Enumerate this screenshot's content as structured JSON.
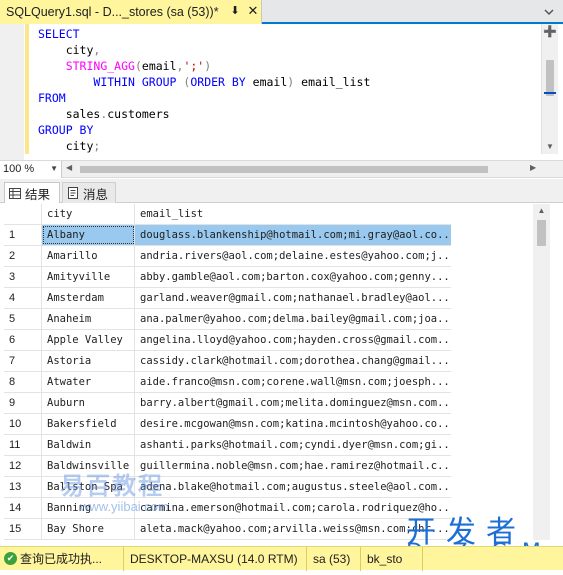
{
  "tab": {
    "title": "SQLQuery1.sql - D..._stores (sa (53))*"
  },
  "editor": {
    "lines": [
      [
        {
          "t": "SELECT",
          "c": "kw"
        }
      ],
      [
        {
          "t": "    city",
          "c": "id"
        },
        {
          "t": ",",
          "c": "gr"
        }
      ],
      [
        {
          "t": "    ",
          "c": "id"
        },
        {
          "t": "STRING_AGG",
          "c": "fn"
        },
        {
          "t": "(",
          "c": "gr"
        },
        {
          "t": "email",
          "c": "id"
        },
        {
          "t": ",",
          "c": "gr"
        },
        {
          "t": "';'",
          "c": "str"
        },
        {
          "t": ")",
          "c": "gr"
        }
      ],
      [
        {
          "t": "        ",
          "c": "id"
        },
        {
          "t": "WITHIN GROUP",
          "c": "kw"
        },
        {
          "t": " (",
          "c": "gr"
        },
        {
          "t": "ORDER BY",
          "c": "kw"
        },
        {
          "t": " email",
          "c": "id"
        },
        {
          "t": ")",
          "c": "gr"
        },
        {
          "t": " email_list",
          "c": "id"
        }
      ],
      [
        {
          "t": "FROM",
          "c": "kw"
        }
      ],
      [
        {
          "t": "    sales",
          "c": "id"
        },
        {
          "t": ".",
          "c": "gr"
        },
        {
          "t": "customers",
          "c": "id"
        }
      ],
      [
        {
          "t": "GROUP BY",
          "c": "kw"
        }
      ],
      [
        {
          "t": "    city",
          "c": "id"
        },
        {
          "t": ";",
          "c": "gr"
        }
      ]
    ]
  },
  "zoom": {
    "value": "100 %"
  },
  "result_tabs": {
    "results": "结果",
    "messages": "消息"
  },
  "grid": {
    "columns": [
      "city",
      "email_list"
    ],
    "rows": [
      {
        "n": "1",
        "city": "Albany",
        "email": "douglass.blankenship@hotmail.com;mi.gray@aol.co..."
      },
      {
        "n": "2",
        "city": "Amarillo",
        "email": "andria.rivers@aol.com;delaine.estes@yahoo.com;j..."
      },
      {
        "n": "3",
        "city": "Amityville",
        "email": "abby.gamble@aol.com;barton.cox@yahoo.com;genny...."
      },
      {
        "n": "4",
        "city": "Amsterdam",
        "email": "garland.weaver@gmail.com;nathanael.bradley@aol...."
      },
      {
        "n": "5",
        "city": "Anaheim",
        "email": "ana.palmer@yahoo.com;delma.bailey@gmail.com;joa..."
      },
      {
        "n": "6",
        "city": "Apple Valley",
        "email": "angelina.lloyd@yahoo.com;hayden.cross@gmail.com..."
      },
      {
        "n": "7",
        "city": "Astoria",
        "email": "cassidy.clark@hotmail.com;dorothea.chang@gmail...."
      },
      {
        "n": "8",
        "city": "Atwater",
        "email": "aide.franco@msn.com;corene.wall@msn.com;joesph...."
      },
      {
        "n": "9",
        "city": "Auburn",
        "email": "barry.albert@gmail.com;melita.dominguez@msn.com..."
      },
      {
        "n": "10",
        "city": "Bakersfield",
        "email": "desire.mcgowan@msn.com;katina.mcintosh@yahoo.co..."
      },
      {
        "n": "11",
        "city": "Baldwin",
        "email": "ashanti.parks@hotmail.com;cyndi.dyer@msn.com;gi..."
      },
      {
        "n": "12",
        "city": "Baldwinsville",
        "email": "guillermina.noble@msn.com;hae.ramirez@hotmail.c..."
      },
      {
        "n": "13",
        "city": "Ballston Spa",
        "email": "adena.blake@hotmail.com;augustus.steele@aol.com..."
      },
      {
        "n": "14",
        "city": "Banning",
        "email": "carmina.emerson@hotmail.com;carola.rodriquez@ho..."
      },
      {
        "n": "15",
        "city": "Bay Shore",
        "email": "aleta.mack@yahoo.com;arvilla.weiss@msn.com;chr..."
      }
    ]
  },
  "watermark": {
    "left_text": "易百教程",
    "left_url": "www.yiibai.com",
    "right_text": "开发者",
    "right_url": "DevZe.CoM"
  },
  "status": {
    "message": "查询已成功执...",
    "server": "DESKTOP-MAXSU (14.0 RTM)",
    "user": "sa (53)",
    "db": "bk_sto"
  },
  "colors": {
    "tab_active": "#fff59d",
    "status_bar": "#fff59d",
    "selection": "#99c9ef",
    "accent": "#007acc",
    "keyword": "#0000ff",
    "function": "#ff00ff",
    "string": "#c00000"
  }
}
